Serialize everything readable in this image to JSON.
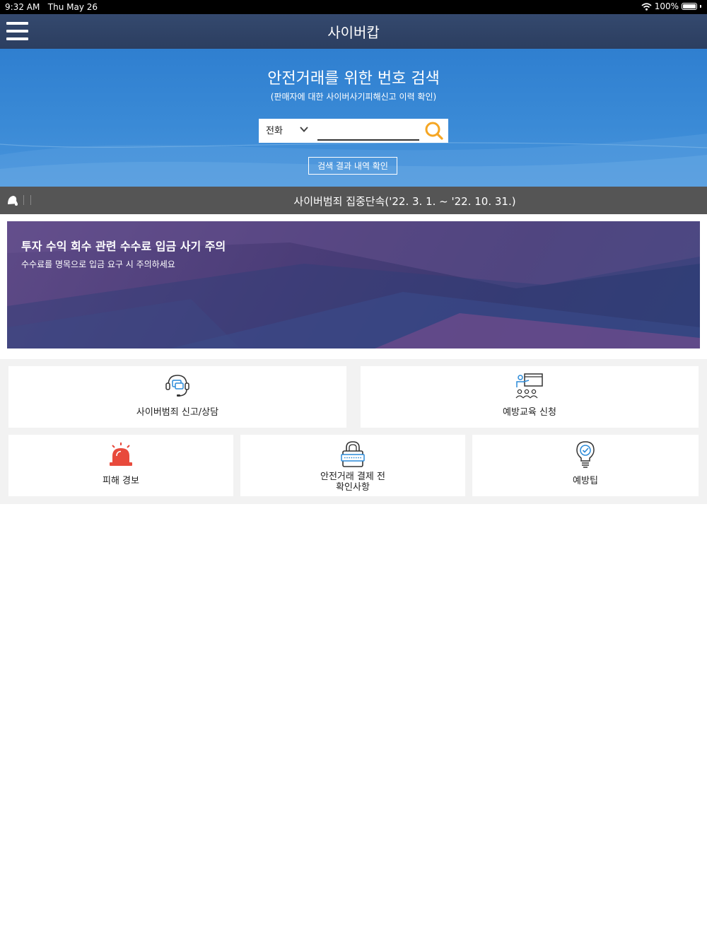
{
  "status_bar": {
    "time": "9:32 AM",
    "date": "Thu May 26",
    "battery": "100%"
  },
  "nav": {
    "title": "사이버캅"
  },
  "hero": {
    "title": "안전거래를 위한 번호 검색",
    "subtitle": "(판매자에 대한 사이버사기피해신고 이력 확인)",
    "search": {
      "type_selected": "전화",
      "query": "",
      "placeholder": ""
    },
    "result_button": "검색 결과 내역 확인"
  },
  "notice": {
    "text": "사이버범죄 집중단속('22. 3. 1. ~ '22. 10. 31.)"
  },
  "banner": {
    "title": "투자 수익 회수 관련 수수료 입금 사기 주의",
    "subtitle": "수수료를 명목으로 입금 요구 시 주의하세요"
  },
  "menu": {
    "report": "사이버범죄 신고/상담",
    "education": "예방교육 신청",
    "alert": "피해 경보",
    "payment_line1": "안전거래 결제 전",
    "payment_line2": "확인사항",
    "tips": "예방팁"
  },
  "icons": {
    "menu": "hamburger-icon",
    "search": "search-icon",
    "chevron": "chevron-down-icon",
    "bell": "bell-icon",
    "report": "headset-chat-icon",
    "education": "presentation-icon",
    "alert": "siren-icon",
    "payment": "lock-card-icon",
    "tips": "lightbulb-check-icon"
  },
  "colors": {
    "nav": "#2c3e60",
    "hero": "#3a8ad6",
    "notice": "#555555",
    "accent": "#f5a623",
    "alert": "#e84a3c",
    "icon_blue": "#2a8ad8"
  }
}
